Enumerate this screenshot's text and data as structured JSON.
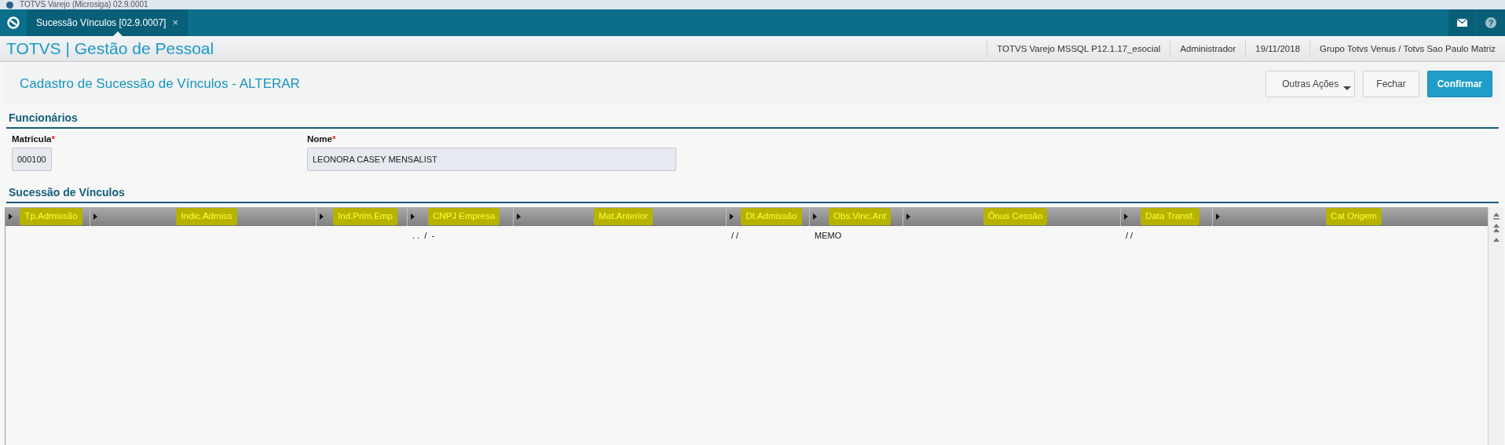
{
  "window": {
    "title": "TOTVS Varejo (Microsiga) 02.9.0001"
  },
  "tabs": [
    {
      "label": "Sucessão Vínculos [02.9.0007]",
      "selected": true,
      "close": "×"
    }
  ],
  "app": {
    "title": "TOTVS | Gestão de Pessoal",
    "info": [
      "TOTVS Varejo MSSQL P12.1.17_esocial",
      "Administrador",
      "19/11/2018",
      "Grupo Totvs Venus / Totvs Sao Paulo Matriz"
    ]
  },
  "page": {
    "title": "Cadastro de Sucessão de Vínculos - ALTERAR",
    "buttons": [
      {
        "label": "Outras Ações",
        "kind": "menu"
      },
      {
        "label": "Fechar",
        "kind": "plain"
      },
      {
        "label": "Confirmar",
        "kind": "primary"
      }
    ]
  },
  "funcionarios": {
    "title": "Funcionários",
    "fields": [
      {
        "label": "Matricula",
        "required": "*",
        "value": "000100"
      },
      {
        "label": "Nome",
        "required": "*",
        "value": "LEONORA CASEY MENSALIST"
      }
    ]
  },
  "grid": {
    "title": "Sucessão de Vínculos",
    "columns": [
      {
        "label": "Tp.Admissão",
        "highlighted": true
      },
      {
        "label": "Indic.Admiss",
        "highlighted": true
      },
      {
        "label": "Ind.Prim.Emp",
        "highlighted": true
      },
      {
        "label": "CNPJ Empresa",
        "highlighted": true,
        "cells": [
          ". .  /  -"
        ]
      },
      {
        "label": "Mat.Anterior",
        "highlighted": true
      },
      {
        "label": "Dt.Admissão",
        "highlighted": true,
        "cells": [
          "/ /"
        ]
      },
      {
        "label": "Obs.Vinc.Ant",
        "highlighted": true,
        "cells": [
          "MEMO"
        ]
      },
      {
        "label": "Ônus Cessão",
        "highlighted": true
      },
      {
        "label": "Data Transf.",
        "highlighted": true,
        "cells": [
          "/ /"
        ]
      },
      {
        "label": "Cat Origem",
        "highlighted": true
      }
    ]
  },
  "help": "?"
}
